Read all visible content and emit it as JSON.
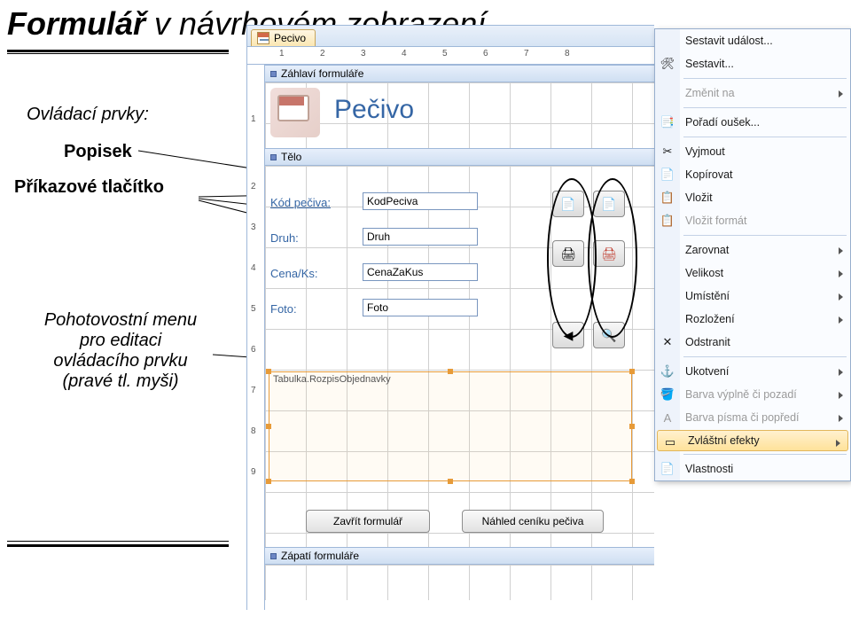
{
  "title": {
    "bold": "Formulář",
    "rest": " v návrhovém zobrazení"
  },
  "left": {
    "controls_heading": "Ovládací prvky:",
    "label": "Popisek",
    "cmd_button": "Příkazové tlačítko",
    "hover_menu": "Pohotovostní menu\npro editaci\novládacího prvku\n(pravé tl. myši)"
  },
  "tab": {
    "name": "Pecivo"
  },
  "ruler_h": [
    "1",
    "2",
    "3",
    "4",
    "5",
    "6",
    "7",
    "8"
  ],
  "ruler_v": [
    "1",
    "2",
    "3",
    "4",
    "5",
    "6",
    "7",
    "8",
    "9"
  ],
  "sections": {
    "header": "Záhlaví formuláře",
    "body": "Tělo",
    "footer": "Zápatí formuláře"
  },
  "form": {
    "title": "Pečivo",
    "rows": [
      {
        "label": "Kód pečiva:",
        "field": "KodPeciva"
      },
      {
        "label": "Druh:",
        "field": "Druh"
      },
      {
        "label": "Cena/Ks:",
        "field": "CenaZaKus"
      },
      {
        "label": "Foto:",
        "field": "Foto"
      }
    ],
    "subform": "Tabulka.RozpisObjednavky",
    "btn_close": "Zavřít formulář",
    "btn_preview": "Náhled ceníku pečiva"
  },
  "cmd_icons": [
    "📄",
    "📄",
    "🖨",
    "🖨",
    "◀",
    "🔍"
  ],
  "menu": [
    {
      "text": "Sestavit událost...",
      "icon": ""
    },
    {
      "text": "Sestavit...",
      "icon": "🛠"
    },
    {
      "sep": true
    },
    {
      "text": "Změnit na",
      "arrow": true,
      "disabled": true
    },
    {
      "sep": true
    },
    {
      "text": "Pořadí oušek...",
      "icon": "📑"
    },
    {
      "sep": true
    },
    {
      "text": "Vyjmout",
      "icon": "✂"
    },
    {
      "text": "Kopírovat",
      "icon": "📄"
    },
    {
      "text": "Vložit",
      "icon": "📋"
    },
    {
      "text": "Vložit formát",
      "icon": "📋",
      "disabled": true
    },
    {
      "sep": true
    },
    {
      "text": "Zarovnat",
      "arrow": true
    },
    {
      "text": "Velikost",
      "arrow": true
    },
    {
      "text": "Umístění",
      "arrow": true
    },
    {
      "text": "Rozložení",
      "arrow": true
    },
    {
      "text": "Odstranit",
      "icon": "✕"
    },
    {
      "sep": true
    },
    {
      "text": "Ukotvení",
      "icon": "⚓",
      "arrow": true
    },
    {
      "text": "Barva výplně či pozadí",
      "icon": "🪣",
      "arrow": true,
      "disabled": true
    },
    {
      "text": "Barva písma či popředí",
      "icon": "A",
      "arrow": true,
      "disabled": true
    },
    {
      "text": "Zvláštní efekty",
      "icon": "▭",
      "arrow": true,
      "highlight": true
    },
    {
      "sep": true
    },
    {
      "text": "Vlastnosti",
      "icon": "📄"
    }
  ]
}
